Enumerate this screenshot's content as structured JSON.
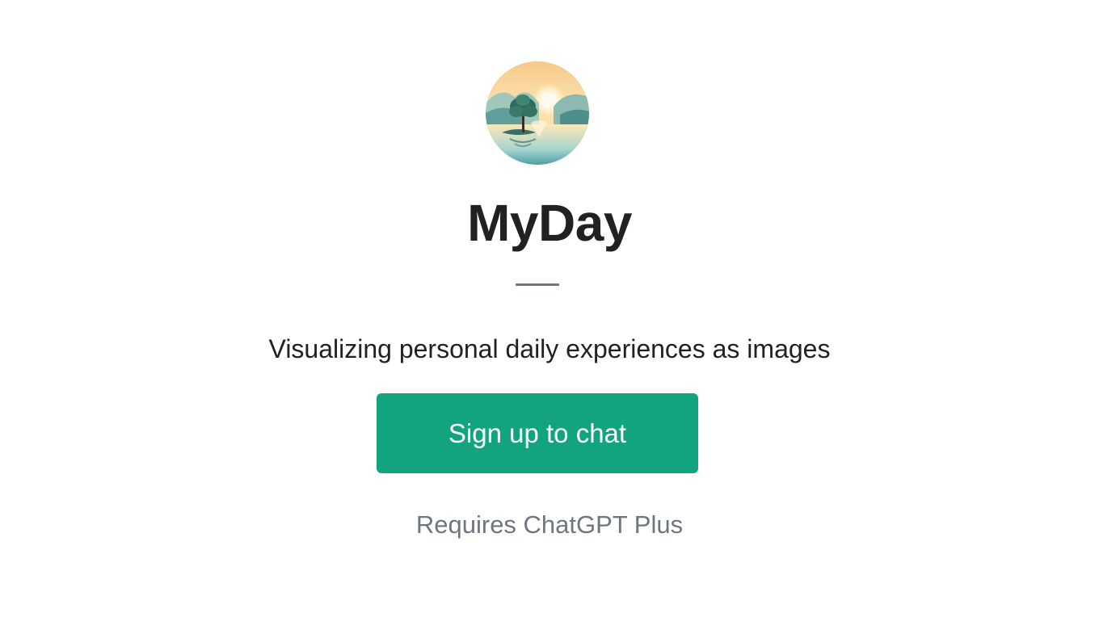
{
  "gpt": {
    "name": "MyDay",
    "description": "Visualizing personal daily experiences as images",
    "avatar_icon": "landscape-lake-tree-sunrise-image"
  },
  "actions": {
    "signup_label": "Sign up to chat"
  },
  "requirement_note": "Requires ChatGPT Plus",
  "colors": {
    "accent": "#12a37f",
    "title_text": "#202123",
    "muted_text": "#6e7681",
    "background": "#ffffff"
  }
}
